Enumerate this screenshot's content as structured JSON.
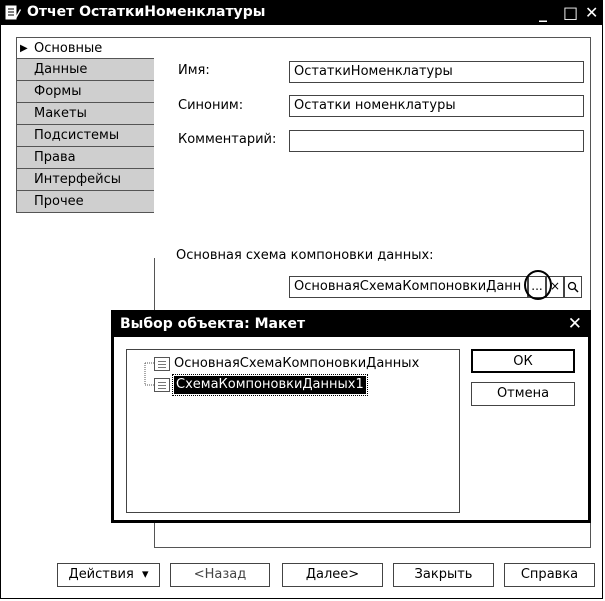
{
  "window": {
    "title": "Отчет ОстаткиНоменклатуры",
    "minimize": "_",
    "maximize": "□",
    "close": "✕"
  },
  "tabs": [
    {
      "label": "Основные",
      "active": true
    },
    {
      "label": "Данные"
    },
    {
      "label": "Формы"
    },
    {
      "label": "Макеты"
    },
    {
      "label": "Подсистемы"
    },
    {
      "label": "Права"
    },
    {
      "label": "Интерфейсы"
    },
    {
      "label": "Прочее"
    }
  ],
  "form": {
    "name_label": "Имя:",
    "name_value": "ОстаткиНоменклатуры",
    "synonym_label": "Синоним:",
    "synonym_value": "Остатки номенклатуры",
    "comment_label": "Комментарий:",
    "comment_value": "",
    "schema_label": "Основная схема компоновки данных:",
    "schema_value": "ОсновнаяСхемаКомпоновкиДанн",
    "select_btn": "...",
    "clear_btn": "×",
    "open_btn": "🔍"
  },
  "dialog": {
    "title": "Выбор объекта: Макет",
    "close": "✕",
    "items": [
      {
        "label": "ОсновнаяСхемаКомпоновкиДанных"
      },
      {
        "label": "СхемаКомпоновкиДанных1",
        "selected": true
      }
    ],
    "ok": "ОК",
    "cancel": "Отмена"
  },
  "footer": {
    "actions": "Действия",
    "actions_arrow": "▾",
    "back": "<Назад",
    "next": "Далее>",
    "close": "Закрыть",
    "help": "Справка"
  }
}
